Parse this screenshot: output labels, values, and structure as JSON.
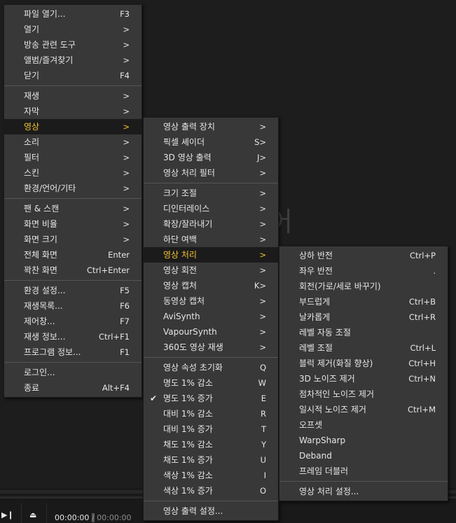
{
  "background": {
    "watermark_text": "어"
  },
  "player": {
    "time_current": "00:00:00",
    "time_separator": "/",
    "time_total": "00:00:00",
    "icons": [
      "play-pause-icon",
      "eject-icon"
    ]
  },
  "main_menu": [
    {
      "label": "파일 열기...",
      "shortcut": "F3"
    },
    {
      "label": "열기",
      "shortcut": ">"
    },
    {
      "label": "방송 관련 도구",
      "shortcut": ">"
    },
    {
      "label": "앨범/즐겨찾기",
      "shortcut": ">"
    },
    {
      "label": "닫기",
      "shortcut": "F4"
    },
    {
      "sep": true
    },
    {
      "label": "재생",
      "shortcut": ">"
    },
    {
      "label": "자막",
      "shortcut": ">"
    },
    {
      "label": "영상",
      "shortcut": ">",
      "active": true
    },
    {
      "label": "소리",
      "shortcut": ">"
    },
    {
      "label": "필터",
      "shortcut": ">"
    },
    {
      "label": "스킨",
      "shortcut": ">"
    },
    {
      "label": "환경/언어/기타",
      "shortcut": ">"
    },
    {
      "sep": true
    },
    {
      "label": "팬 & 스캔",
      "shortcut": ">"
    },
    {
      "label": "화면 비율",
      "shortcut": ">"
    },
    {
      "label": "화면 크기",
      "shortcut": ">"
    },
    {
      "label": "전체 화면",
      "shortcut": "Enter"
    },
    {
      "label": "꽉찬 화면",
      "shortcut": "Ctrl+Enter"
    },
    {
      "sep": true
    },
    {
      "label": "환경 설정...",
      "shortcut": "F5"
    },
    {
      "label": "재생목록...",
      "shortcut": "F6"
    },
    {
      "label": "제어창...",
      "shortcut": "F7"
    },
    {
      "label": "재생 정보...",
      "shortcut": "Ctrl+F1"
    },
    {
      "label": "프로그램 정보...",
      "shortcut": "F1"
    },
    {
      "sep": true
    },
    {
      "label": "로그인...",
      "shortcut": ""
    },
    {
      "label": "종료",
      "shortcut": "Alt+F4"
    }
  ],
  "video_menu": [
    {
      "label": "영상 출력 장치",
      "shortcut": ">"
    },
    {
      "label": "픽셀 셰이더",
      "shortcut": "S>"
    },
    {
      "label": "3D 영상 출력",
      "shortcut": "J>"
    },
    {
      "label": "영상 처리 필터",
      "shortcut": ">"
    },
    {
      "sep": true
    },
    {
      "label": "크기 조절",
      "shortcut": ">"
    },
    {
      "label": "디인터레이스",
      "shortcut": ">"
    },
    {
      "label": "확장/잘라내기",
      "shortcut": ">"
    },
    {
      "label": "하단 여백",
      "shortcut": ">"
    },
    {
      "label": "영상 처리",
      "shortcut": ">",
      "active": true
    },
    {
      "label": "영상 회전",
      "shortcut": ">"
    },
    {
      "label": "영상 캡처",
      "shortcut": "K>"
    },
    {
      "label": "동영상 캡처",
      "shortcut": ">"
    },
    {
      "label": "AviSynth",
      "shortcut": ">"
    },
    {
      "label": "VapourSynth",
      "shortcut": ">"
    },
    {
      "label": "360도 영상 재생",
      "shortcut": ">"
    },
    {
      "sep": true
    },
    {
      "label": "영상 속성 초기화",
      "shortcut": "Q"
    },
    {
      "label": "명도 1% 감소",
      "shortcut": "W"
    },
    {
      "label": "명도 1% 증가",
      "shortcut": "E",
      "checked": true
    },
    {
      "label": "대비 1% 감소",
      "shortcut": "R"
    },
    {
      "label": "대비 1% 증가",
      "shortcut": "T"
    },
    {
      "label": "채도 1% 감소",
      "shortcut": "Y"
    },
    {
      "label": "채도 1% 증가",
      "shortcut": "U"
    },
    {
      "label": "색상 1% 감소",
      "shortcut": "I"
    },
    {
      "label": "색상 1% 증가",
      "shortcut": "O"
    },
    {
      "sep": true
    },
    {
      "label": "영상 출력 설정...",
      "shortcut": ""
    }
  ],
  "processing_menu": [
    {
      "label": "상하 반전",
      "shortcut": "Ctrl+P"
    },
    {
      "label": "좌우 반전",
      "shortcut": "."
    },
    {
      "label": "회전(가로/세로 바꾸기)",
      "shortcut": ""
    },
    {
      "label": "부드럽게",
      "shortcut": "Ctrl+B"
    },
    {
      "label": "날카롭게",
      "shortcut": "Ctrl+R"
    },
    {
      "label": "레벨 자동 조절",
      "shortcut": ""
    },
    {
      "label": "레벨 조절",
      "shortcut": "Ctrl+L"
    },
    {
      "label": "블럭 제거(화질 향상)",
      "shortcut": "Ctrl+H"
    },
    {
      "label": "3D 노이즈 제거",
      "shortcut": "Ctrl+N"
    },
    {
      "label": "점차적인 노이즈 제거",
      "shortcut": ""
    },
    {
      "label": "일시적 노이즈 제거",
      "shortcut": "Ctrl+M"
    },
    {
      "label": "오프셋",
      "shortcut": ""
    },
    {
      "label": "WarpSharp",
      "shortcut": ""
    },
    {
      "label": "Deband",
      "shortcut": ""
    },
    {
      "label": "프레임 더블러",
      "shortcut": ""
    },
    {
      "sep": true
    },
    {
      "label": "영상 처리 설정...",
      "shortcut": ""
    }
  ],
  "colors": {
    "highlight_text": "#f2c230",
    "menu_bg": "#383838",
    "active_bg": "#1b1b1b"
  }
}
